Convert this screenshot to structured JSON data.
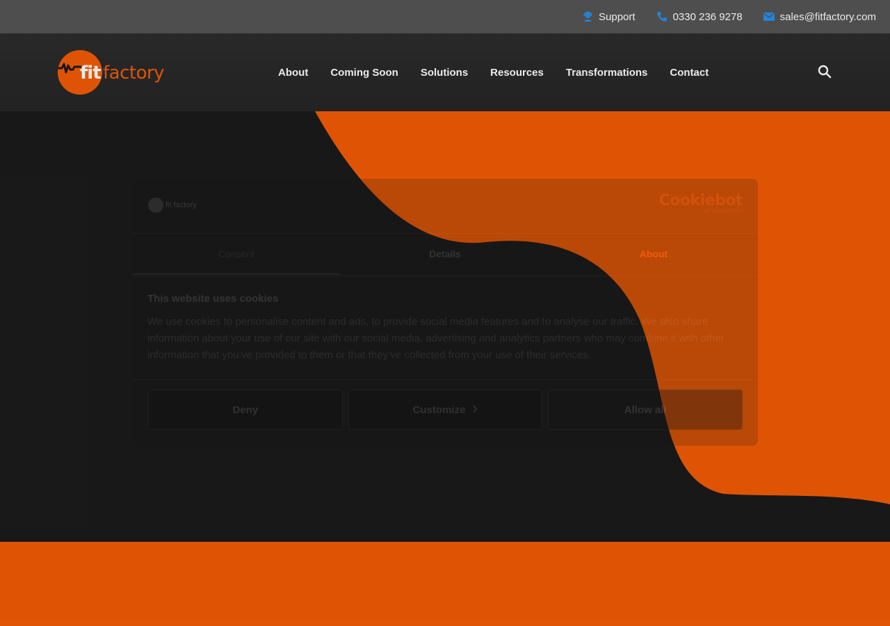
{
  "topbar": {
    "support": "Support",
    "phone": "0330 236 9278",
    "email": "sales@fitfactory.com"
  },
  "logo": {
    "fit": "fit",
    "factory": "factory"
  },
  "nav": {
    "items": [
      {
        "label": "About"
      },
      {
        "label": "Coming Soon"
      },
      {
        "label": "Solutions"
      },
      {
        "label": "Resources"
      },
      {
        "label": "Transformations"
      },
      {
        "label": "Contact"
      }
    ]
  },
  "cookie_dialog": {
    "logo_text": "fit factory",
    "brand": "Cookiebot",
    "brand_sub": "by Usercentrics",
    "tabs": [
      {
        "label": "Consent"
      },
      {
        "label": "Details"
      },
      {
        "label": "About"
      }
    ],
    "heading": "This website uses cookies",
    "body": "We use cookies to personalise content and ads, to provide social media features and to analyse our traffic. We also share information about your use of our site with our social media, advertising and analytics partners who may combine it with other information that you’ve provided to them or that they’ve collected from your use of their services.",
    "buttons": {
      "deny": "Deny",
      "customize": "Customize",
      "allow": "Allow all"
    }
  },
  "colors": {
    "brand_orange": "#f25c05",
    "topbar_bg": "#555555",
    "header_bg": "#2a2a2a",
    "hero_bg": "#1b1b1b",
    "icon_blue": "#2b8ee8"
  },
  "icons": {
    "support": "headset-icon",
    "phone": "phone-icon",
    "email": "envelope-icon",
    "search": "search-icon",
    "chevron": "chevron-right-icon"
  }
}
